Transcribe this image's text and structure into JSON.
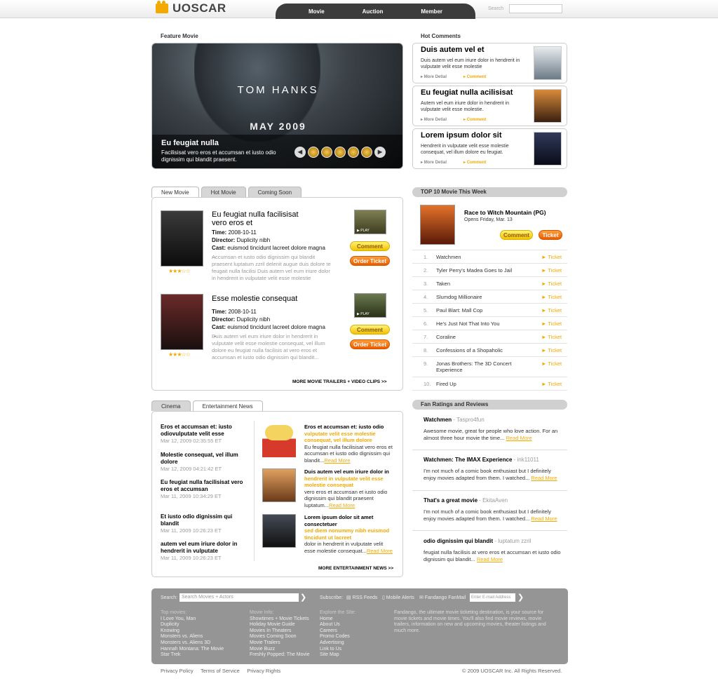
{
  "header": {
    "logo": "UOSCAR",
    "nav": [
      "Movie",
      "Auction",
      "Member"
    ],
    "search_label": "Search"
  },
  "feature": {
    "section": "Feature Movie",
    "line1": "TOM HANKS",
    "line2": "MAY 2009",
    "title": "Eu feugiat nulla",
    "desc": "Facilisisat vero eros et accumsan et iusto odio dignissim qui blandit praesent.",
    "prev": "◀",
    "next": "▶"
  },
  "hot": {
    "section": "Hot Comments",
    "items": [
      {
        "title": "Duis autem vel et",
        "desc": "Duis autem vel eum iriure dolor in hendrerit in vulputate velit esse molestie",
        "more": "More Detial",
        "comment": "Comment"
      },
      {
        "title": "Eu feugiat nulla acilisisat",
        "desc": "Autem vel eum iriure dolor in hendrerit in vulputate velit esse molestie.",
        "more": "More Detial",
        "comment": "Comment"
      },
      {
        "title": "Lorem ipsum dolor sit",
        "desc": "Hendrerit in vulputate velit esse molestie consequat, vel illum dolore eu feugiat.",
        "more": "More Detial",
        "comment": "Comment"
      }
    ]
  },
  "movies": {
    "tabs": [
      "New Movie",
      "Hot Movie",
      "Coming Soon"
    ],
    "items": [
      {
        "title": "Eu feugiat nulla facilisisat vero eros et",
        "time": "2008-10-11",
        "director": "Duplicity nibh",
        "cast": "euismod tincidunt lacreet dolore magna ...",
        "desc": "Accumsan et iusto odio dignissim qui blandit praesent luptatum zzril delenit augue duis dolore te feugait nulla facilisi Duis autem vel eum iriure dolor in hendrerit in vulputate velit esse molestie"
      },
      {
        "title": "Esse molestie consequat",
        "time": "2008-10-11",
        "director": "Duplicity nibh",
        "cast": "euismod tincidunt lacreet dolore magna ...",
        "desc": "Duis autem vel eum iriure dolor in hendrerit in vulputate velit esse molestie consequat, vel illum dolore eu feugiat nulla facilisis at vero eros et accumsan et iusto odio dignissim qui blandit..."
      }
    ],
    "labels": {
      "time": "Time:",
      "director": "Director:",
      "cast": "Cast:"
    },
    "stars": "★★★☆☆",
    "play": "PLAY",
    "comment_btn": "Comment",
    "ticket_btn": "Order Ticket",
    "more": "MORE MOVIE TRAILERS + VIDEO CLIPS >>"
  },
  "top10": {
    "section": "TOP 10 Movie This Week",
    "featured": {
      "title": "Race to Witch Mountain (PG)",
      "sub": "Opens Friday, Mar. 13",
      "comment": "Comment",
      "ticket": "Ticket"
    },
    "list": [
      "Watchmen",
      "Tyler Perry's Madea Goes to Jail",
      "Taken",
      "Slumdog Millionaire",
      "Paul Blart: Mall Cop",
      "He's Just Not That Into You",
      "Coraline",
      "Confessions of a Shopaholic",
      "Jonas Brothers: The 3D Concert Experience",
      "Fired Up"
    ],
    "nums": [
      "1.",
      "2.",
      "3.",
      "4.",
      "5.",
      "6.",
      "7.",
      "8.",
      "9.",
      "10."
    ],
    "ticket": "► Ticket"
  },
  "news": {
    "tabs": [
      "Cinema",
      "Entertainment News"
    ],
    "left": [
      {
        "t": "Eros et accumsan et: iusto odiovulputate velit esse",
        "d": "Mar 12, 2009 02:35:55 ET"
      },
      {
        "t": "Molestie consequat, vel illum dolore",
        "d": "Mar 12, 2009 04:21:42 ET"
      },
      {
        "t": "Eu feugiat nulla facilisisat vero eros et accumsan",
        "d": "Mar 11, 2009 10:34:29 ET"
      },
      {
        "t": "Et iusto odio dignissim qui blandit",
        "d": "Mar 11, 2009 10:26:23 ET"
      },
      {
        "t": "autem vel eum iriure dolor in hendrerit in vulputate",
        "d": "Mar 11, 2009 10:26:23 ET"
      }
    ],
    "right": [
      {
        "t": "Eros et accumsan et: iusto odio",
        "o": "vulputate velit esse molestie consequat, vel illum dolore",
        "b": "Eu feugiat nulla facilisisat vero eros et accumsan et iusto odio dignissim qui blandit...",
        "r": "Read More"
      },
      {
        "t": "Duis autem vel eum iriure dolor in",
        "o": "hendrerit in vulputate velit esse molestie consequat",
        "b": "vero eros et accumsan et iusto odio dignissim qui blandit praesent luptatum...",
        "r": "Read More"
      },
      {
        "t": "Lorem ipsum dolor sit amet consectetuer",
        "o": "sed diem nonummy nibh euismod tincidunt ut lacreet",
        "b": "dolor in hendrerit in vulputate velit esse molestie consequat...",
        "r": "Read More"
      }
    ],
    "more": "MORE ENTERTAINMENT NEWS >>"
  },
  "ratings": {
    "section": "Fan Ratings and Reviews",
    "items": [
      {
        "t": "Watchmen",
        "u": " - Taspro4fun",
        "p": "Awesome movie, great for people who love action. For an almost three hour movie the time...",
        "r": "Read More"
      },
      {
        "t": "Watchmen: The IMAX Experience",
        "u": " - ink11011",
        "p": "I'm not much of a comic book enthusiast but I definitely enjoy movies adapted from them. I watched...",
        "r": "Read More"
      },
      {
        "t": "That's a great movie",
        "u": " - EkitaAven",
        "p": "I'm not much of a comic book enthusiast but I definitely enjoy movies adapted from them. I watched...",
        "r": "Read More"
      },
      {
        "t": "odio dignissim qui blandit",
        "u": " - luptatum zzril",
        "p": "feugiat nulla facilisis at vero eros et accumsan et iusto odio dignissim qui blandit...",
        "r": "Read More"
      }
    ]
  },
  "footer": {
    "search_label": "Search:",
    "search_ph": "Search Movies + Actors",
    "subscribe": "Subscribe:",
    "rss": "RSS Feeds",
    "mobile": "Mobile Alerts",
    "fanmail": "Fandango FanMail",
    "email_ph": "Enter E-mail Address",
    "col1": [
      "Top movies:",
      "I Love You, Man",
      "Duplicity",
      "Knowing",
      "Monsters vs. Aliens",
      "Monsters vs. Aliens 3D",
      "Hannah Montana: The Movie",
      "Star Trek"
    ],
    "col2": [
      "Movie Info:",
      "Showtimes + Movie Tickets",
      "Holiday Movie Guide",
      "Movies In Theaters",
      "Movies Coming Soon",
      "Movie Trailers",
      "Movie Buzz",
      "Freshly Popped: The Movie"
    ],
    "col3": [
      "Explore the Site:",
      "Home",
      "About Us",
      "Careers",
      "Promo Codes",
      "Advertising",
      "Link to Us",
      "Site Map"
    ],
    "about": "Fandango, the ultimate movie ticketing destination, is your source for movie tickets and movie times. You'll also find movie reviews, movie trailers, information on new and upcoming movies, theater listings and much more."
  },
  "bottom": {
    "links": [
      "Privacy Policy",
      "Terms of Service",
      "Privacy Rights"
    ],
    "copy": "© 2009 UOSCAR Inc. All Rights Reserved."
  }
}
